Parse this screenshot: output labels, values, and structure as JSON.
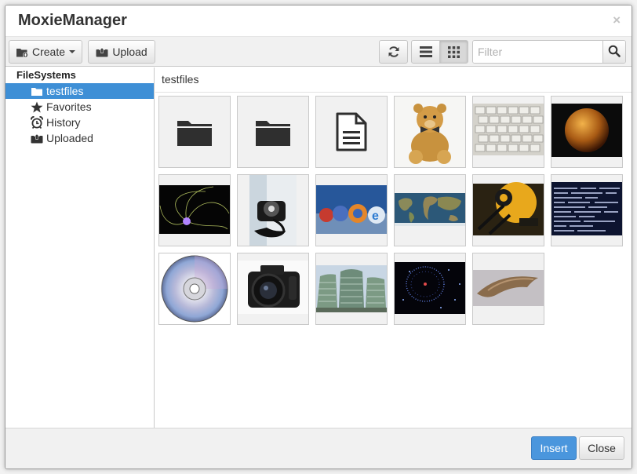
{
  "window": {
    "title": "MoxieManager",
    "close_glyph": "×"
  },
  "toolbar": {
    "create_label": "Create",
    "upload_label": "Upload",
    "refresh_icon": "refresh-icon",
    "list_view_icon": "list-view-icon",
    "grid_view_icon": "grid-view-icon",
    "active_view": "grid",
    "filter_placeholder": "Filter",
    "filter_value": ""
  },
  "sidebar": {
    "root_label": "FileSystems",
    "items": [
      {
        "label": "testfiles",
        "icon": "folder-open-icon",
        "selected": true
      },
      {
        "label": "Favorites",
        "icon": "star-icon",
        "selected": false
      },
      {
        "label": "History",
        "icon": "alarm-clock-icon",
        "selected": false
      },
      {
        "label": "Uploaded",
        "icon": "upload-box-icon",
        "selected": false
      }
    ]
  },
  "main": {
    "current_path": "testfiles",
    "files": [
      {
        "kind": "folder",
        "icon": "folder-icon"
      },
      {
        "kind": "folder",
        "icon": "folder-icon"
      },
      {
        "kind": "document",
        "icon": "document-icon"
      },
      {
        "kind": "image",
        "icon": "teddy-bear-image"
      },
      {
        "kind": "image",
        "icon": "keyboard-image"
      },
      {
        "kind": "image",
        "icon": "planet-image"
      },
      {
        "kind": "image",
        "icon": "light-trails-image"
      },
      {
        "kind": "image",
        "icon": "telephone-image"
      },
      {
        "kind": "image",
        "icon": "browser-logos-image"
      },
      {
        "kind": "image",
        "icon": "world-map-image"
      },
      {
        "kind": "image",
        "icon": "gear-machine-image"
      },
      {
        "kind": "image",
        "icon": "terminal-text-image"
      },
      {
        "kind": "image",
        "icon": "cd-disc-image"
      },
      {
        "kind": "image",
        "icon": "camera-image"
      },
      {
        "kind": "image",
        "icon": "building-image"
      },
      {
        "kind": "image",
        "icon": "particle-ring-image"
      },
      {
        "kind": "image",
        "icon": "claw-image"
      }
    ]
  },
  "footer": {
    "insert_label": "Insert",
    "close_label": "Close"
  },
  "colors": {
    "accent": "#3e8fd6",
    "primary_button": "#4a96dd",
    "toolbar_bg": "#f1f1f1",
    "tile_bg": "#f1f1f1"
  }
}
